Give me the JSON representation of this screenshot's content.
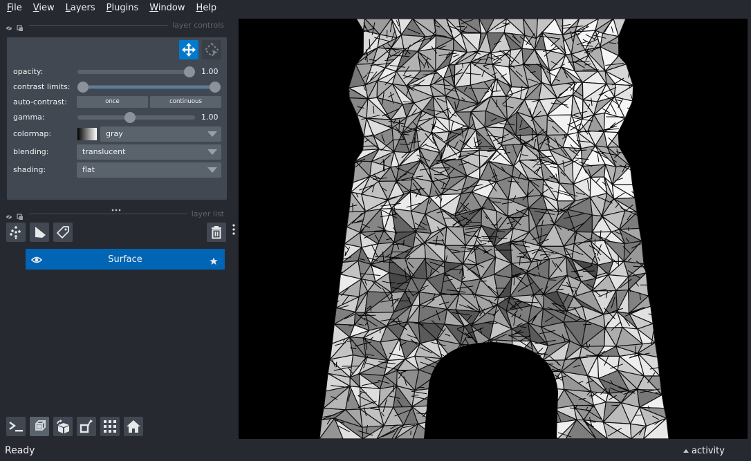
{
  "menubar": {
    "items": [
      {
        "label": "File",
        "mnemonic": "F",
        "rest": "ile"
      },
      {
        "label": "View",
        "mnemonic": "V",
        "rest": "iew"
      },
      {
        "label": "Layers",
        "mnemonic": "L",
        "rest": "ayers"
      },
      {
        "label": "Plugins",
        "mnemonic": "P",
        "rest": "lugins"
      },
      {
        "label": "Window",
        "mnemonic": "W",
        "rest": "indow"
      },
      {
        "label": "Help",
        "mnemonic": "H",
        "rest": "elp"
      }
    ]
  },
  "layer_controls": {
    "title": "layer controls",
    "mode_buttons": [
      {
        "name": "pan-zoom",
        "icon": "move-arrows-icon",
        "active": true
      },
      {
        "name": "transform",
        "icon": "select-transform-icon",
        "active": false
      }
    ],
    "opacity": {
      "label": "opacity:",
      "value": 1.0,
      "display": "1.00"
    },
    "contrast_limits": {
      "label": "contrast limits:",
      "low": 0.0,
      "high": 1.0
    },
    "auto_contrast": {
      "label": "auto-contrast:",
      "once": "once",
      "continuous": "continuous"
    },
    "gamma": {
      "label": "gamma:",
      "value": 1.0,
      "min": 0.2,
      "max": 2.0,
      "display": "1.00"
    },
    "colormap": {
      "label": "colormap:",
      "value": "gray"
    },
    "blending": {
      "label": "blending:",
      "value": "translucent"
    },
    "shading": {
      "label": "shading:",
      "value": "flat"
    }
  },
  "layer_list": {
    "title": "layer list",
    "tools": [
      {
        "name": "new-points",
        "icon": "points-icon"
      },
      {
        "name": "new-shapes",
        "icon": "shapes-icon"
      },
      {
        "name": "new-labels",
        "icon": "labels-tag-icon"
      }
    ],
    "delete_icon": "trash-icon",
    "layers": [
      {
        "name": "Surface",
        "visible": true,
        "selected": true
      }
    ]
  },
  "viewer_buttons": [
    {
      "name": "console",
      "icon": "terminal-icon",
      "active": false
    },
    {
      "name": "ndisplay",
      "icon": "3d-cube-icon",
      "active": true
    },
    {
      "name": "roll",
      "icon": "rotate-cube-icon",
      "active": false
    },
    {
      "name": "transpose",
      "icon": "transpose-icon",
      "active": false
    },
    {
      "name": "grid",
      "icon": "grid-icon",
      "active": false
    },
    {
      "name": "home",
      "icon": "home-icon",
      "active": false
    }
  ],
  "status": {
    "text": "Ready",
    "activity": "activity"
  },
  "colors": {
    "accent": "#007acc",
    "layer_selected": "#0065b5",
    "background": "#262930",
    "panel": "#414851",
    "control": "#5a626c"
  }
}
